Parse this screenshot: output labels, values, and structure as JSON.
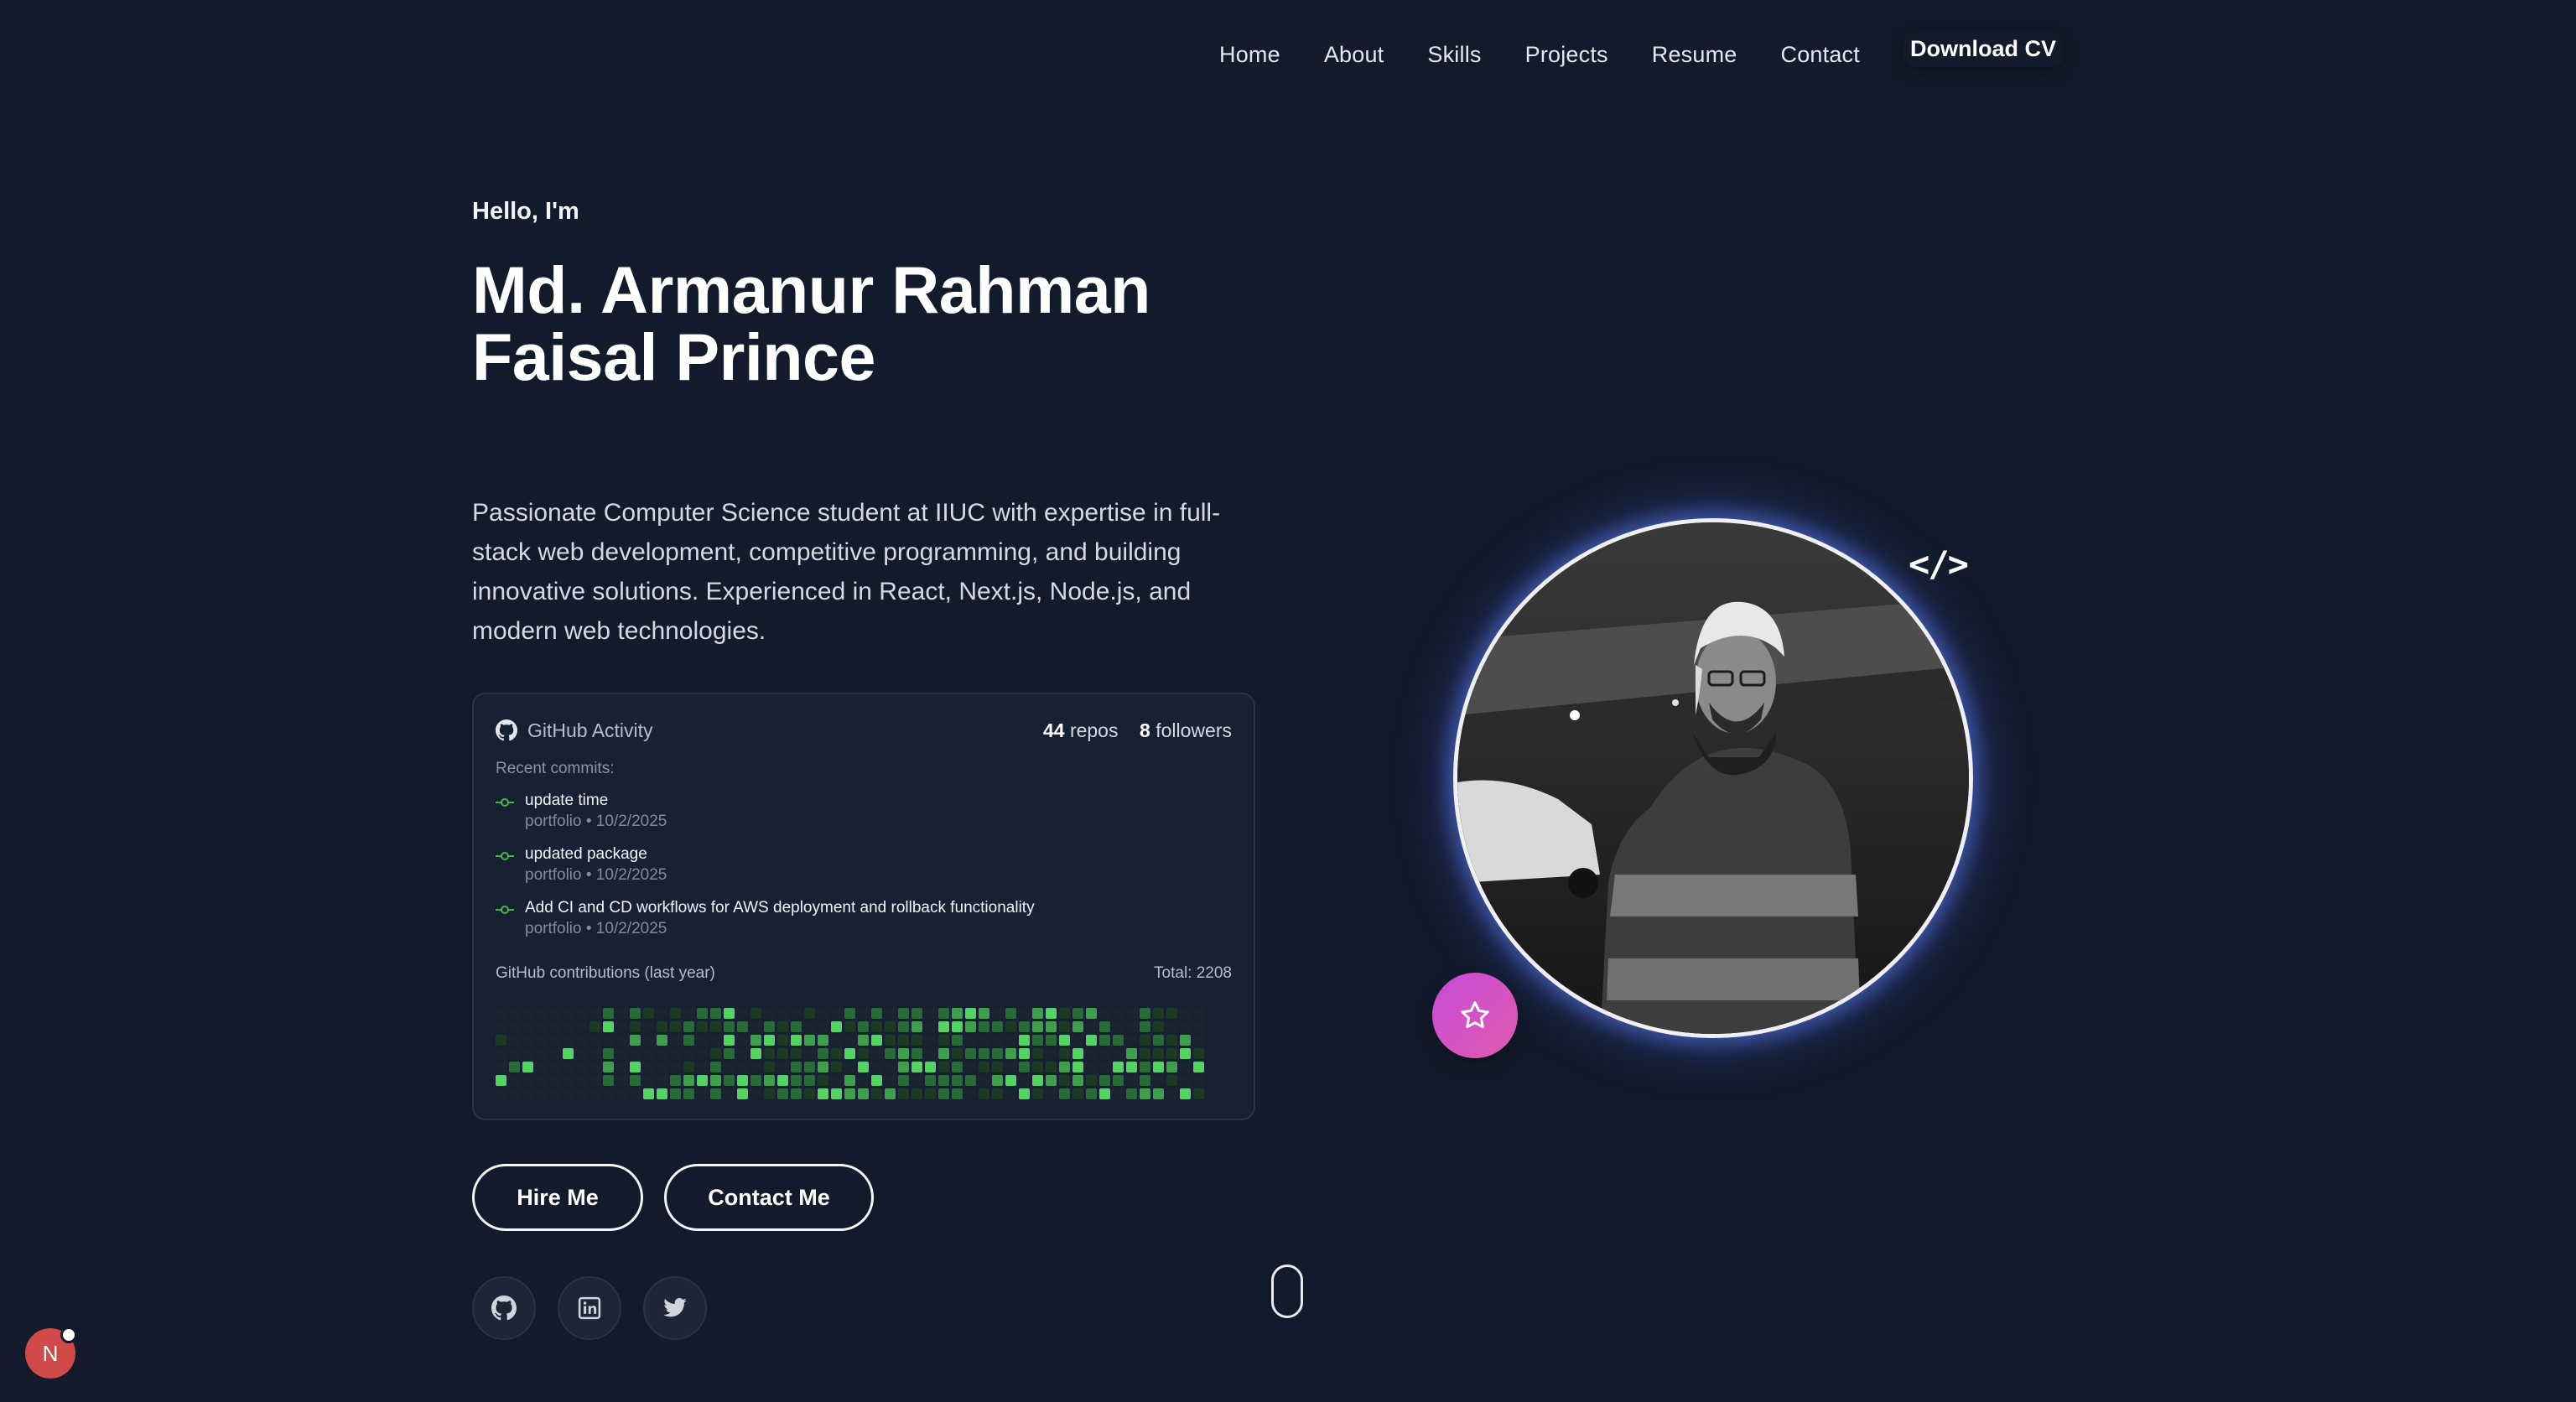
{
  "nav": {
    "items": [
      "Home",
      "About",
      "Skills",
      "Projects",
      "Resume",
      "Contact"
    ],
    "download_label": "Download CV"
  },
  "hero": {
    "greeting": "Hello, I'm",
    "name_line1": "Md. Armanur Rahman",
    "name_line2": "Faisal Prince",
    "description": "Passionate Computer Science student at IIUC with expertise in full-stack web development, competitive programming, and building innovative solutions. Experienced in React, Next.js, Node.js, and modern web technologies."
  },
  "github": {
    "title": "GitHub Activity",
    "repos_count": "44",
    "repos_label": "repos",
    "followers_count": "8",
    "followers_label": "followers",
    "recent_label": "Recent commits:",
    "commits": [
      {
        "message": "update time",
        "meta": "portfolio • 10/2/2025"
      },
      {
        "message": "updated package",
        "meta": "portfolio • 10/2/2025"
      },
      {
        "message": "Add CI and CD workflows for AWS deployment and rollback functionality",
        "meta": "portfolio • 10/2/2025"
      }
    ],
    "contrib_label": "GitHub contributions (last year)",
    "contrib_total": "Total: 2208"
  },
  "buttons": {
    "hire": "Hire Me",
    "contact": "Contact Me"
  },
  "social": [
    "github-icon",
    "linkedin-icon",
    "twitter-icon"
  ],
  "badge": {
    "letter": "N"
  },
  "colors": {
    "background": "#131a2b",
    "accent_pink": "#d04fc9",
    "github_green": "#3fb950",
    "glow_blue": "#5a78e6"
  }
}
